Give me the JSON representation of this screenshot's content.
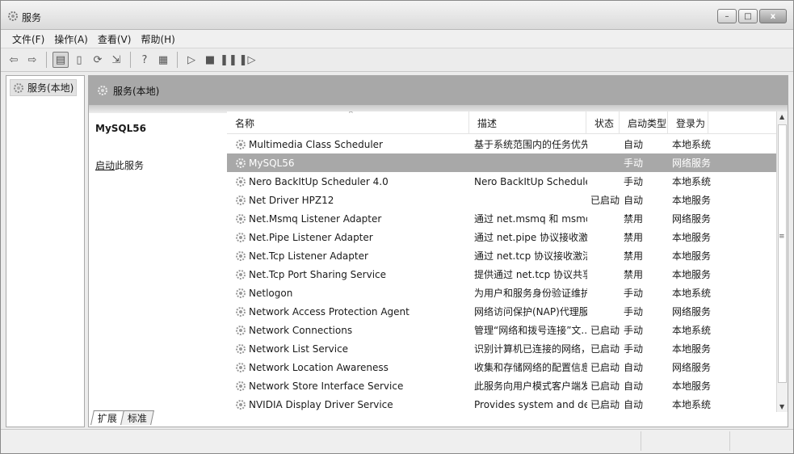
{
  "window": {
    "title": "服务",
    "buttons": {
      "minimize": "–",
      "maximize": "□",
      "close": "x"
    }
  },
  "menu": [
    "文件(F)",
    "操作(A)",
    "查看(V)",
    "帮助(H)"
  ],
  "tree": {
    "item": "服务(本地)"
  },
  "pane": {
    "header": "服务(本地)",
    "selected_service": "MySQL56",
    "start_link_prefix": "启动",
    "start_link_suffix": "此服务"
  },
  "columns": [
    "名称",
    "描述",
    "状态",
    "启动类型",
    "登录为"
  ],
  "rows": [
    {
      "name": "Multimedia Class Scheduler",
      "desc": "基于系统范围内的任务优先...",
      "status": "",
      "start": "自动",
      "logon": "本地系统"
    },
    {
      "name": "MySQL56",
      "desc": "",
      "status": "",
      "start": "手动",
      "logon": "网络服务",
      "selected": true
    },
    {
      "name": "Nero BackItUp Scheduler 4.0",
      "desc": "Nero BackItUp Scheduler ...",
      "status": "",
      "start": "手动",
      "logon": "本地系统"
    },
    {
      "name": "Net Driver HPZ12",
      "desc": "",
      "status": "已启动",
      "start": "自动",
      "logon": "本地服务"
    },
    {
      "name": "Net.Msmq Listener Adapter",
      "desc": "通过 net.msmq 和 msmq.f...",
      "status": "",
      "start": "禁用",
      "logon": "网络服务"
    },
    {
      "name": "Net.Pipe Listener Adapter",
      "desc": "通过 net.pipe 协议接收激活...",
      "status": "",
      "start": "禁用",
      "logon": "本地服务"
    },
    {
      "name": "Net.Tcp Listener Adapter",
      "desc": "通过 net.tcp 协议接收激活...",
      "status": "",
      "start": "禁用",
      "logon": "本地服务"
    },
    {
      "name": "Net.Tcp Port Sharing Service",
      "desc": "提供通过 net.tcp 协议共享 T...",
      "status": "",
      "start": "禁用",
      "logon": "本地服务"
    },
    {
      "name": "Netlogon",
      "desc": "为用户和服务身份验证维护...",
      "status": "",
      "start": "手动",
      "logon": "本地系统"
    },
    {
      "name": "Network Access Protection Agent",
      "desc": "网络访问保护(NAP)代理服务...",
      "status": "",
      "start": "手动",
      "logon": "网络服务"
    },
    {
      "name": "Network Connections",
      "desc": "管理“网络和拨号连接”文...",
      "status": "已启动",
      "start": "手动",
      "logon": "本地系统"
    },
    {
      "name": "Network List Service",
      "desc": "识别计算机已连接的网络，...",
      "status": "已启动",
      "start": "手动",
      "logon": "本地服务"
    },
    {
      "name": "Network Location Awareness",
      "desc": "收集和存储网络的配置信息...",
      "status": "已启动",
      "start": "自动",
      "logon": "网络服务"
    },
    {
      "name": "Network Store Interface Service",
      "desc": "此服务向用户模式客户端发...",
      "status": "已启动",
      "start": "自动",
      "logon": "本地服务"
    },
    {
      "name": "NVIDIA Display Driver Service",
      "desc": "Provides system and desk...",
      "status": "已启动",
      "start": "自动",
      "logon": "本地系统"
    }
  ],
  "tabs": [
    "扩展",
    "标准"
  ],
  "toolbar_icons": [
    "back-arrow-icon",
    "forward-arrow-icon",
    "console-tree-icon",
    "properties-icon",
    "refresh-icon",
    "export-icon",
    "help-icon",
    "view-icon",
    "play-icon",
    "stop-icon",
    "pause-icon",
    "restart-icon"
  ]
}
